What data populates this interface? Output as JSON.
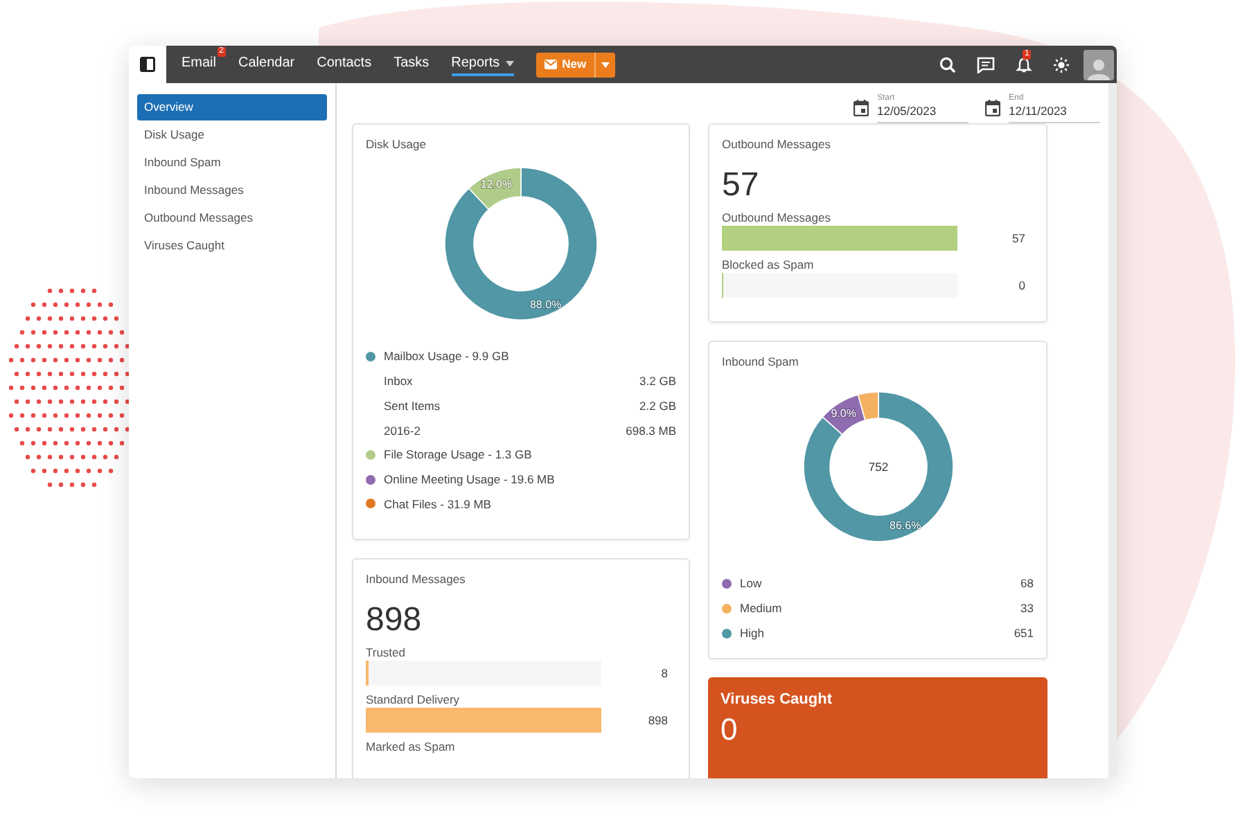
{
  "topbar": {
    "nav": [
      {
        "label": "Email",
        "badge": "2",
        "selected": false,
        "dropdown": false
      },
      {
        "label": "Calendar",
        "selected": false,
        "dropdown": false
      },
      {
        "label": "Contacts",
        "selected": false,
        "dropdown": false
      },
      {
        "label": "Tasks",
        "selected": false,
        "dropdown": false
      },
      {
        "label": "Reports",
        "selected": true,
        "dropdown": true
      }
    ],
    "new_button": {
      "label": "New"
    },
    "notifications_badge": "1"
  },
  "sidebar": {
    "items": [
      {
        "label": "Overview",
        "selected": true
      },
      {
        "label": "Disk Usage",
        "selected": false
      },
      {
        "label": "Inbound Spam",
        "selected": false
      },
      {
        "label": "Inbound Messages",
        "selected": false
      },
      {
        "label": "Outbound Messages",
        "selected": false
      },
      {
        "label": "Viruses Caught",
        "selected": false
      }
    ]
  },
  "date_range": {
    "start": {
      "label": "Start",
      "value": "12/05/2023"
    },
    "end": {
      "label": "End",
      "value": "12/11/2023"
    }
  },
  "disk_usage": {
    "title": "Disk Usage",
    "chart_data": {
      "type": "donut",
      "values": [
        88.0,
        12.0
      ],
      "colors": [
        "#5197a5",
        "#b0cc8a"
      ],
      "value_labels": [
        "88.0%",
        "12.0%"
      ]
    },
    "legend": [
      {
        "label": "Mailbox Usage - 9.9 GB",
        "color": "#5197a5",
        "children": [
          {
            "label": "Inbox",
            "value": "3.2 GB"
          },
          {
            "label": "Sent Items",
            "value": "2.2 GB"
          },
          {
            "label": "2016-2",
            "value": "698.3 MB"
          }
        ]
      },
      {
        "label": "File Storage Usage - 1.3 GB",
        "color": "#b0cc8a"
      },
      {
        "label": "Online Meeting Usage - 19.6 MB",
        "color": "#8f6cb0"
      },
      {
        "label": "Chat Files - 31.9 MB",
        "color": "#e07b24"
      }
    ]
  },
  "outbound_messages": {
    "title": "Outbound Messages",
    "total": "57",
    "bars": [
      {
        "label": "Outbound Messages",
        "level": 1,
        "value": "57"
      },
      {
        "label": "Blocked as Spam",
        "level": 0,
        "value": "0"
      }
    ]
  },
  "inbound_spam": {
    "title": "Inbound Spam",
    "total": "752",
    "chart_data": {
      "type": "donut",
      "values": [
        86.6,
        9.0,
        4.4
      ],
      "colors": [
        "#5197a5",
        "#8f6cb0",
        "#f5b162"
      ],
      "value_labels": [
        "86.6%",
        "9.0%",
        null
      ]
    },
    "legend": [
      {
        "label": "Low",
        "value": "68",
        "color": "#8f6cb0"
      },
      {
        "label": "Medium",
        "value": "33",
        "color": "#f5b162"
      },
      {
        "label": "High",
        "value": "651",
        "color": "#5197a5"
      }
    ]
  },
  "inbound_messages": {
    "title": "Inbound Messages",
    "total": "898",
    "bars": [
      {
        "label": "Trusted",
        "level": 0.009,
        "value": "8"
      },
      {
        "label": "Standard Delivery",
        "level": 1,
        "value": "898"
      },
      {
        "label": "Marked as Spam"
      }
    ]
  },
  "viruses_caught": {
    "title": "Viruses Caught",
    "total": "0"
  }
}
